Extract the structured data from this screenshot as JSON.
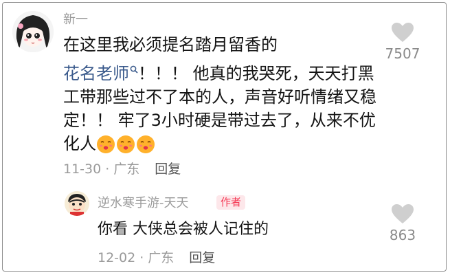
{
  "comment": {
    "username": "新一",
    "text_line1": "在这里我必须提名踏月留香的",
    "mention": "花名老师",
    "text_rest": "！！！ 他真的我哭死，天天打黑工带那些过不了本的人，声音好听情绪又稳定！！ 牢了3小时硬是带过去了，从来不优化人",
    "emoji_count": 3,
    "date": "11-30",
    "dot": "·",
    "location": "广东",
    "reply_label": "回复",
    "like_count": "7507"
  },
  "reply": {
    "username": "逆水寒手游-天天",
    "author_badge": "作者",
    "text": "你看  大侠总会被人记住的",
    "date": "12-02",
    "dot": "·",
    "location": "广东",
    "reply_label": "回复",
    "like_count": "863"
  },
  "colors": {
    "mention": "#3a5a8c",
    "badge_bg": "#fde7ea",
    "badge_text": "#f53a55",
    "meta": "#9a9a9a",
    "like_icon": "#cfcfcf"
  }
}
